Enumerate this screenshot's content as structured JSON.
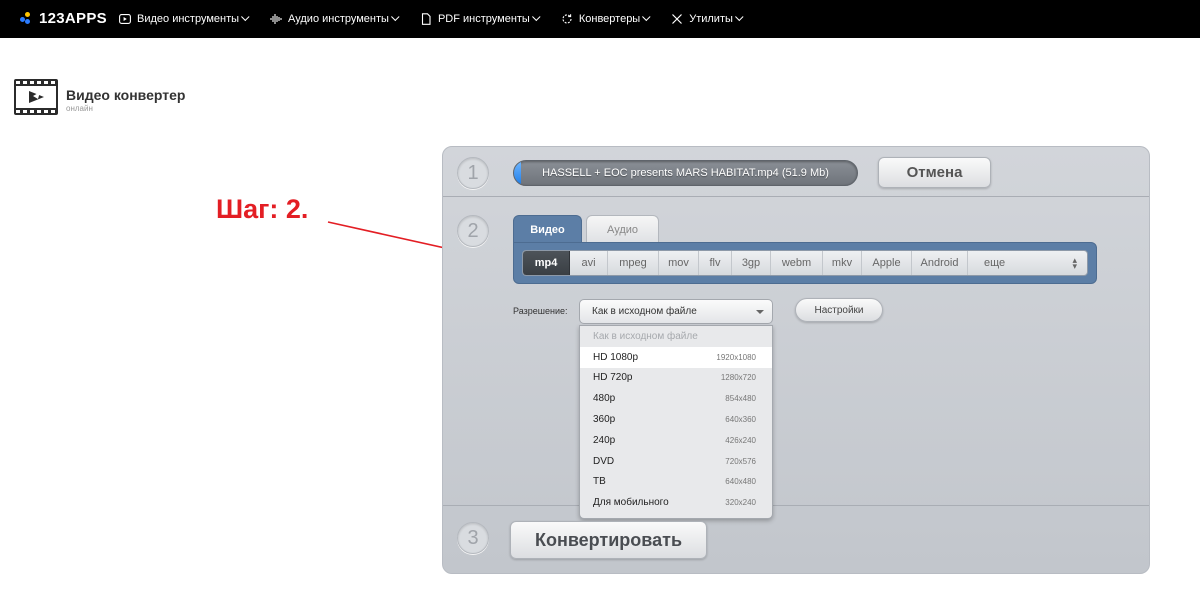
{
  "brand": {
    "name": "123APPS"
  },
  "nav": [
    {
      "label": "Видео инструменты",
      "icon": "play-icon"
    },
    {
      "label": "Аудио инструменты",
      "icon": "waveform-icon"
    },
    {
      "label": "PDF инструменты",
      "icon": "document-icon"
    },
    {
      "label": "Конвертеры",
      "icon": "refresh-icon"
    },
    {
      "label": "Утилиты",
      "icon": "tools-icon"
    }
  ],
  "page": {
    "title": "Видео конвертер",
    "subtitle": "онлайн",
    "icon": "video-converter-icon"
  },
  "annotation": {
    "text": "Шаг: 2.",
    "color": "#e31e24"
  },
  "steps": [
    "1",
    "2",
    "3"
  ],
  "upload": {
    "file_label": "HASSELL + EOC presents MARS HABITAT.mp4 (51.9 Mb)",
    "progress": 0.02,
    "cancel_label": "Отмена"
  },
  "tabs": [
    {
      "label": "Видео",
      "active": true
    },
    {
      "label": "Аудио",
      "active": false
    }
  ],
  "formats": {
    "items": [
      "mp4",
      "avi",
      "mpeg",
      "mov",
      "flv",
      "3gp",
      "webm",
      "mkv",
      "Apple",
      "Android"
    ],
    "selected": "mp4",
    "more_label": "еще"
  },
  "resolution": {
    "label": "Разрешение:",
    "selected": "Как в исходном файле",
    "settings_label": "Настройки",
    "options": [
      {
        "label": "Как в исходном файле",
        "res": "",
        "disabled": true
      },
      {
        "label": "HD 1080p",
        "res": "1920x1080",
        "hover": true
      },
      {
        "label": "HD 720p",
        "res": "1280x720"
      },
      {
        "label": "480p",
        "res": "854x480"
      },
      {
        "label": "360p",
        "res": "640x360"
      },
      {
        "label": "240p",
        "res": "426x240"
      },
      {
        "label": "DVD",
        "res": "720x576"
      },
      {
        "label": "ТВ",
        "res": "640x480"
      },
      {
        "label": "Для мобильного",
        "res": "320x240"
      }
    ]
  },
  "convert_label": "Конвертировать",
  "colors": {
    "accent_blue": "#5c7ea6",
    "progress_blue": "#1f7ee8",
    "logo_blue": "#2b7cff",
    "logo_yellow": "#ffc400"
  }
}
